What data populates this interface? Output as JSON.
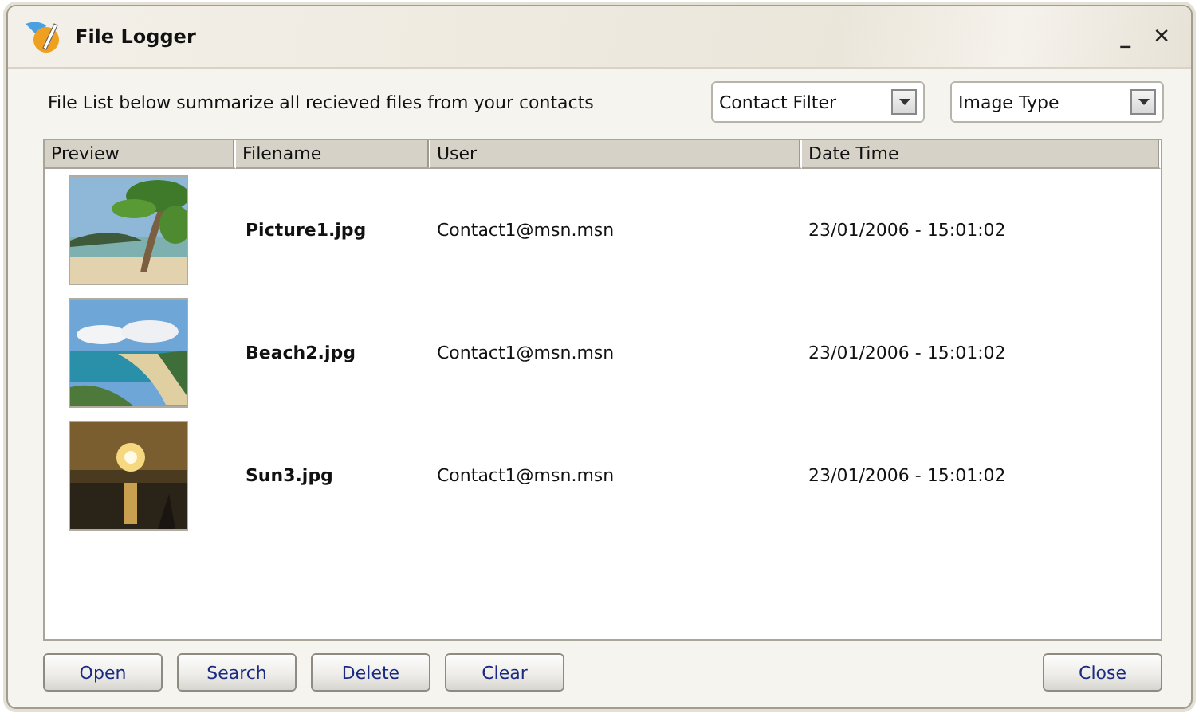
{
  "window": {
    "title": "File Logger",
    "controls": [
      "_",
      "✕"
    ]
  },
  "description": "File List below summarize all recieved files from your contacts",
  "filters": [
    {
      "label": "Contact Filter"
    },
    {
      "label": "Image Type"
    }
  ],
  "table": {
    "columns": [
      "Preview",
      "Filename",
      "User",
      "Date Time"
    ],
    "rows": [
      {
        "filename": "Picture1.jpg",
        "user": "Contact1@msn.msn",
        "date_time": "23/01/2006 - 15:01:02"
      },
      {
        "filename": "Beach2.jpg",
        "user": "Contact1@msn.msn",
        "date_time": "23/01/2006 - 15:01:02"
      },
      {
        "filename": "Sun3.jpg",
        "user": "Contact1@msn.msn",
        "date_time": "23/01/2006 - 15:01:02"
      }
    ]
  },
  "buttons": [
    "Open",
    "Search",
    "Delete",
    "Clear"
  ],
  "close_button": "Close"
}
